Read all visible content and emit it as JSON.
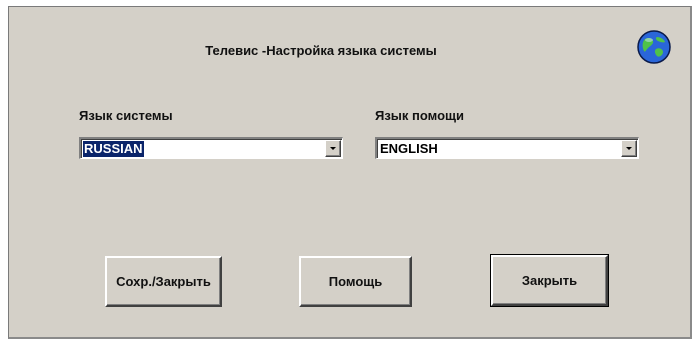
{
  "window": {
    "title": "Телевис -Настройка языка системы"
  },
  "icons": {
    "globe": "globe-icon",
    "dropdown_arrow": "chevron-down-icon"
  },
  "system_language": {
    "label": "Язык системы",
    "value": "RUSSIAN"
  },
  "help_language": {
    "label": "Язык помощи",
    "value": "ENGLISH"
  },
  "buttons": {
    "save_close": "Сохр./Закрыть",
    "help": "Помощь",
    "close": "Закрыть"
  },
  "colors": {
    "background": "#d4d0c8",
    "selection": "#0a246a"
  }
}
